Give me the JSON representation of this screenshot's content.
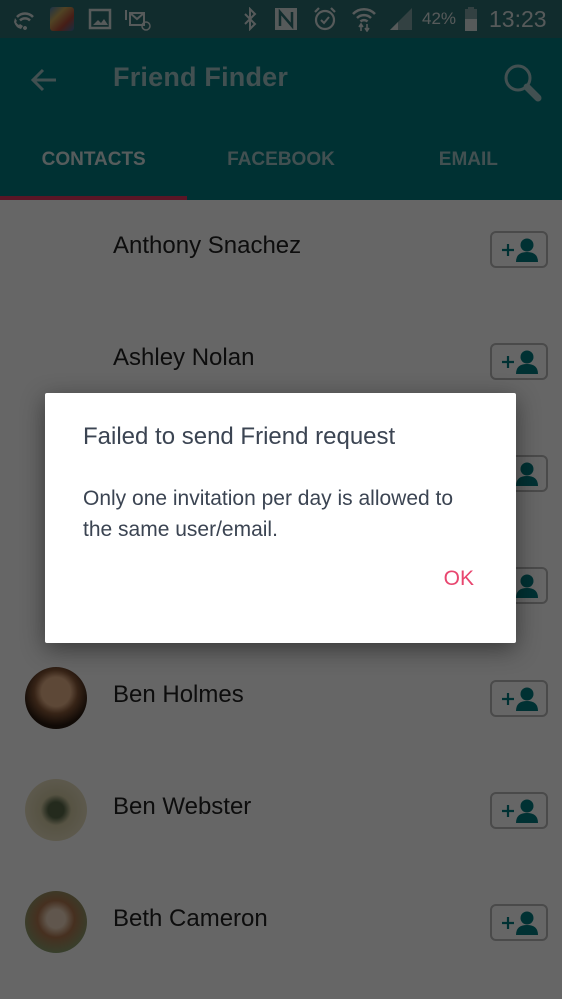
{
  "status_bar": {
    "left_icons": [
      "wifi-calling-icon",
      "game-notification-icon",
      "gallery-icon",
      "email-notification-icon"
    ],
    "right_icons": [
      "bluetooth-icon",
      "nfc-icon",
      "alarm-icon",
      "wifi-icon",
      "cellular-signal-icon"
    ],
    "battery": "42%",
    "time": "13:23"
  },
  "app_bar": {
    "title": "Friend Finder",
    "back_icon": "arrow-back-icon",
    "search_icon": "search-icon"
  },
  "tabs": [
    {
      "label": "CONTACTS",
      "active": true
    },
    {
      "label": "FACEBOOK",
      "active": false
    },
    {
      "label": "EMAIL",
      "active": false
    }
  ],
  "contacts": [
    {
      "name": "Anthony Snachez",
      "has_avatar": false
    },
    {
      "name": "Ashley Nolan",
      "has_avatar": false
    },
    {
      "name": "",
      "has_avatar": false
    },
    {
      "name": "",
      "has_avatar": false
    },
    {
      "name": "Ben Holmes",
      "has_avatar": true
    },
    {
      "name": "Ben Webster",
      "has_avatar": true
    },
    {
      "name": "Beth Cameron",
      "has_avatar": true
    }
  ],
  "dialog": {
    "title": "Failed to send Friend request",
    "message": "Only one invitation per day is allowed to the same user/email.",
    "ok_label": "OK"
  },
  "colors": {
    "primary": "#007b80",
    "accent": "#e0365f",
    "dialog_button": "#e8466f",
    "add_icon": "#007b80"
  }
}
